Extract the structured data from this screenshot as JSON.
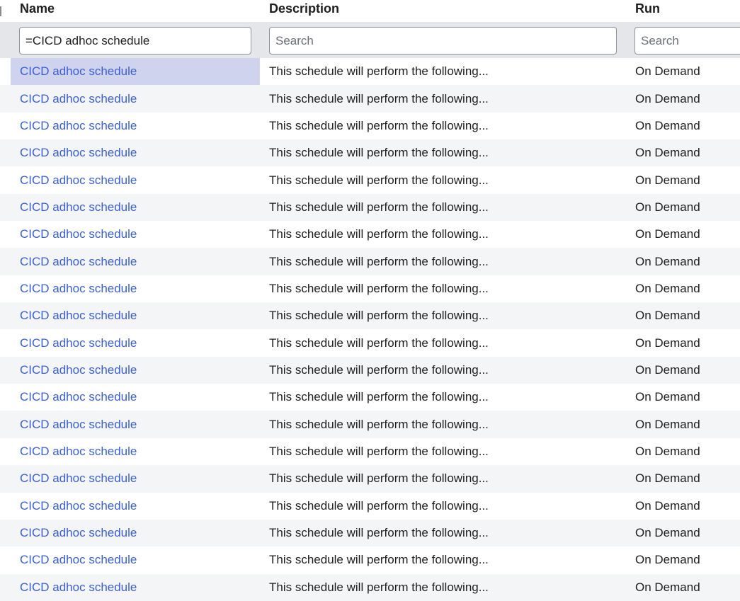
{
  "columns": {
    "name": "Name",
    "description": "Description",
    "run": "Run"
  },
  "filters": {
    "name_value": "=CICD adhoc schedule",
    "description_placeholder": "Search",
    "run_placeholder": "Search"
  },
  "rows": [
    {
      "name": "CICD adhoc schedule",
      "description": "This schedule will perform the following...",
      "run": "On Demand"
    },
    {
      "name": "CICD adhoc schedule",
      "description": "This schedule will perform the following...",
      "run": "On Demand"
    },
    {
      "name": "CICD adhoc schedule",
      "description": "This schedule will perform the following...",
      "run": "On Demand"
    },
    {
      "name": "CICD adhoc schedule",
      "description": "This schedule will perform the following...",
      "run": "On Demand"
    },
    {
      "name": "CICD adhoc schedule",
      "description": "This schedule will perform the following...",
      "run": "On Demand"
    },
    {
      "name": "CICD adhoc schedule",
      "description": "This schedule will perform the following...",
      "run": "On Demand"
    },
    {
      "name": "CICD adhoc schedule",
      "description": "This schedule will perform the following...",
      "run": "On Demand"
    },
    {
      "name": "CICD adhoc schedule",
      "description": "This schedule will perform the following...",
      "run": "On Demand"
    },
    {
      "name": "CICD adhoc schedule",
      "description": "This schedule will perform the following...",
      "run": "On Demand"
    },
    {
      "name": "CICD adhoc schedule",
      "description": "This schedule will perform the following...",
      "run": "On Demand"
    },
    {
      "name": "CICD adhoc schedule",
      "description": "This schedule will perform the following...",
      "run": "On Demand"
    },
    {
      "name": "CICD adhoc schedule",
      "description": "This schedule will perform the following...",
      "run": "On Demand"
    },
    {
      "name": "CICD adhoc schedule",
      "description": "This schedule will perform the following...",
      "run": "On Demand"
    },
    {
      "name": "CICD adhoc schedule",
      "description": "This schedule will perform the following...",
      "run": "On Demand"
    },
    {
      "name": "CICD adhoc schedule",
      "description": "This schedule will perform the following...",
      "run": "On Demand"
    },
    {
      "name": "CICD adhoc schedule",
      "description": "This schedule will perform the following...",
      "run": "On Demand"
    },
    {
      "name": "CICD adhoc schedule",
      "description": "This schedule will perform the following...",
      "run": "On Demand"
    },
    {
      "name": "CICD adhoc schedule",
      "description": "This schedule will perform the following...",
      "run": "On Demand"
    },
    {
      "name": "CICD adhoc schedule",
      "description": "This schedule will perform the following...",
      "run": "On Demand"
    },
    {
      "name": "CICD adhoc schedule",
      "description": "This schedule will perform the following...",
      "run": "On Demand"
    }
  ],
  "colors": {
    "link": "#3a5fd1",
    "selected_row": "#d0d3ee",
    "alt_row": "#f4f5f7",
    "filter_bar": "#e4e6ea"
  }
}
